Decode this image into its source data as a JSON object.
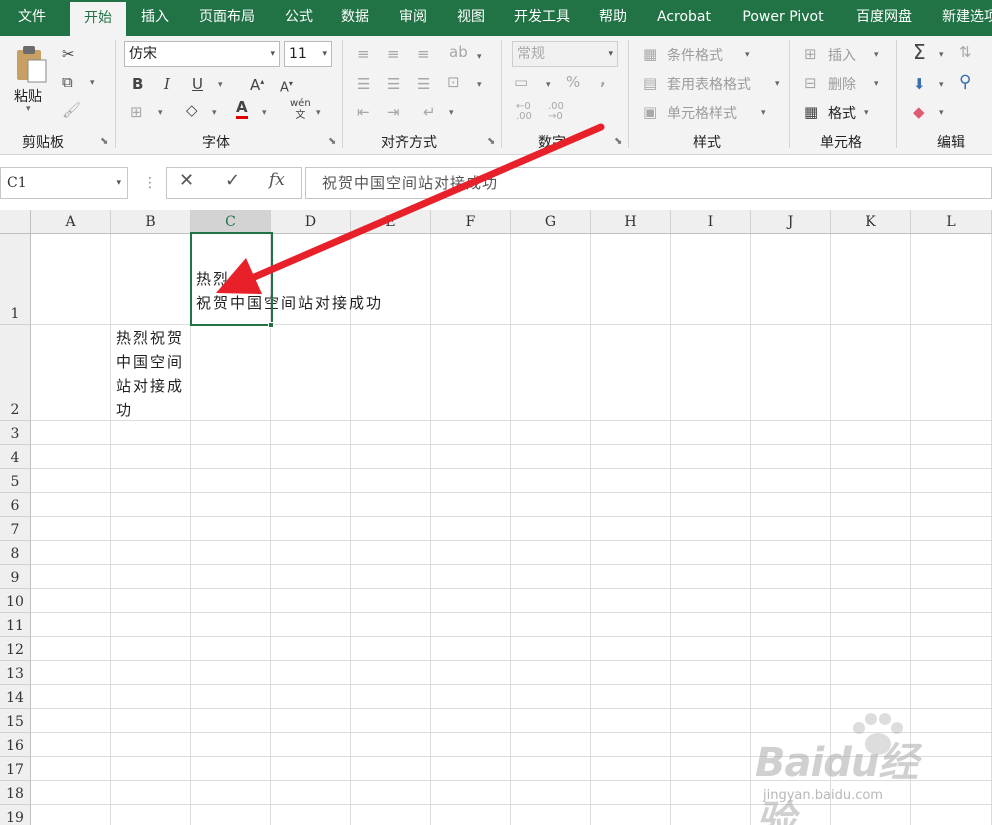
{
  "tabs": [
    "文件",
    "开始",
    "插入",
    "页面布局",
    "公式",
    "数据",
    "审阅",
    "视图",
    "开发工具",
    "帮助",
    "Acrobat",
    "Power Pivot",
    "百度网盘",
    "新建选项"
  ],
  "active_tab": "开始",
  "ribbon": {
    "clipboard": {
      "paste_label": "粘贴",
      "group_label": "剪贴板"
    },
    "font": {
      "font_name": "仿宋",
      "font_size": "11",
      "group_label": "字体",
      "phonetic_glyph": "wén"
    },
    "alignment": {
      "group_label": "对齐方式"
    },
    "number": {
      "format": "常规",
      "group_label": "数字"
    },
    "styles": {
      "conditional_format": "条件格式",
      "table_format": "套用表格格式",
      "cell_styles": "单元格样式",
      "group_label": "样式"
    },
    "cells": {
      "insert": "插入",
      "delete": "删除",
      "format": "格式",
      "group_label": "单元格"
    },
    "editing": {
      "group_label": "编辑"
    }
  },
  "formula_bar": {
    "name_box": "C1",
    "fx": "fx",
    "content": "祝贺中国空间站对接成功"
  },
  "grid": {
    "columns": [
      "A",
      "B",
      "C",
      "D",
      "E",
      "F",
      "G",
      "H",
      "I",
      "J",
      "K",
      "L"
    ],
    "selected_column": "C",
    "rows": [
      "1",
      "2",
      "3",
      "4",
      "5",
      "6",
      "7",
      "8",
      "9",
      "10",
      "11",
      "12",
      "13",
      "14",
      "15",
      "16",
      "17",
      "18",
      "19"
    ],
    "selected_cell": "C1",
    "cell_c1": "热烈\n祝贺中国空间站对接成功",
    "cell_b2": "热烈祝贺\n中国空间\n站对接成\n功"
  },
  "watermark": {
    "main": "Baidu经验",
    "sub": "jingyan.baidu.com"
  },
  "colors": {
    "accent": "#217346",
    "annotation": "#e8202a"
  }
}
